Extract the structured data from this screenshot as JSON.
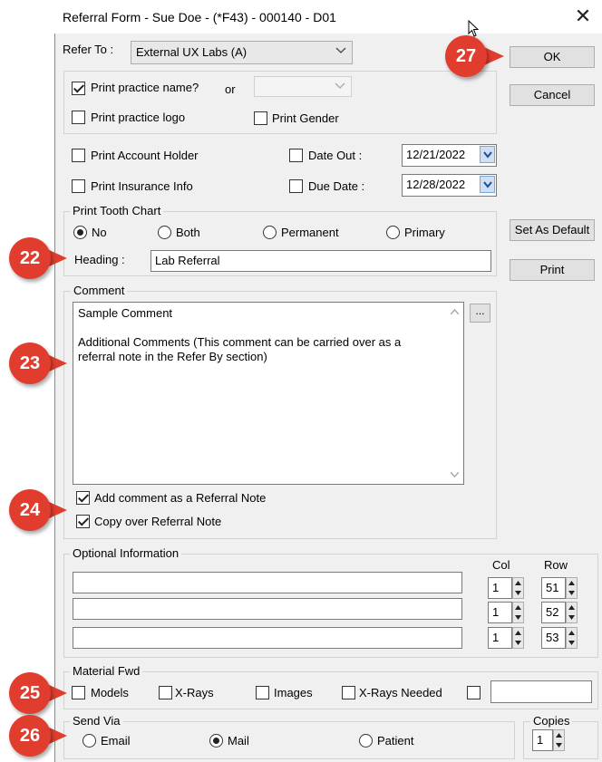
{
  "window": {
    "title": "Referral Form - Sue Doe - (*F43) - 000140 - D01",
    "close_glyph": "✕"
  },
  "refer_to": {
    "label": "Refer To :",
    "value": "External UX Labs (A)"
  },
  "print_practice_name": {
    "label": "Print practice name?",
    "checked": true
  },
  "or_label": "or",
  "or_combo": {
    "value": ""
  },
  "print_practice_logo": {
    "label": "Print practice logo",
    "checked": false
  },
  "print_gender": {
    "label": "Print Gender",
    "checked": false
  },
  "print_account_holder": {
    "label": "Print Account Holder",
    "checked": false
  },
  "print_insurance_info": {
    "label": "Print Insurance Info",
    "checked": false
  },
  "date_out": {
    "label": "Date Out :",
    "value": "12/21/2022",
    "checked": false
  },
  "due_date": {
    "label": "Due Date :",
    "value": "12/28/2022",
    "checked": false
  },
  "tooth_chart": {
    "legend": "Print Tooth Chart",
    "options": [
      "No",
      "Both",
      "Permanent",
      "Primary"
    ],
    "selected": "No"
  },
  "heading": {
    "label": "Heading :",
    "value": "Lab Referral"
  },
  "comment": {
    "legend": "Comment",
    "line1": "Sample Comment",
    "line2": "Additional Comments (This comment can be carried over as a",
    "line3": "referral note in the Refer By section)",
    "ellipsis": "..."
  },
  "add_comment_note": {
    "label": "Add comment as a Referral Note",
    "checked": true
  },
  "copy_referral_note": {
    "label": "Copy over Referral Note",
    "checked": true
  },
  "optional_info": {
    "legend": "Optional Information",
    "col_header": "Col",
    "row_header": "Row",
    "rows": [
      {
        "text": "",
        "col": "1",
        "row": "51"
      },
      {
        "text": "",
        "col": "1",
        "row": "52"
      },
      {
        "text": "",
        "col": "1",
        "row": "53"
      }
    ]
  },
  "material_fwd": {
    "legend": "Material Fwd",
    "options": [
      "Models",
      "X-Rays",
      "Images",
      "X-Rays Needed"
    ],
    "other_text": ""
  },
  "send_via": {
    "legend": "Send Via",
    "options": [
      "Email",
      "Mail",
      "Patient"
    ],
    "selected": "Mail"
  },
  "copies": {
    "label": "Copies",
    "value": "1"
  },
  "buttons": {
    "ok": "OK",
    "cancel": "Cancel",
    "set_default": "Set As Default",
    "print": "Print"
  },
  "markers": {
    "m22": "22",
    "m23": "23",
    "m24": "24",
    "m25": "25",
    "m26": "26",
    "m27": "27"
  },
  "colors": {
    "marker": "#e03d2e",
    "window_bg": "#f0f0f0",
    "date_button": "#cfe0f5"
  }
}
